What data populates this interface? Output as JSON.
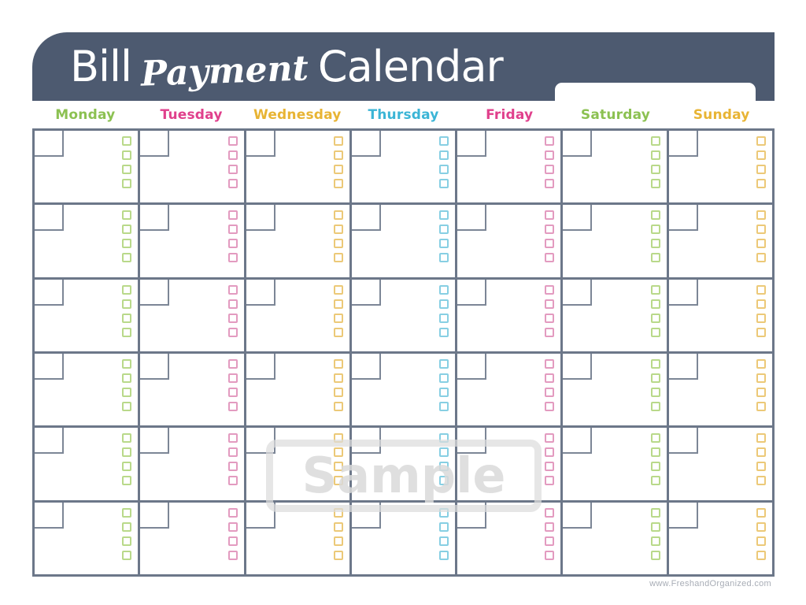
{
  "page": {
    "background": "#ffffff",
    "header_color": "#4d5a70",
    "grid_line_color": "#6c7789"
  },
  "header": {
    "title_part1": "Bill",
    "title_script": "Payment",
    "title_part2": "Calendar",
    "month_input_value": "",
    "month_input_placeholder": ""
  },
  "days": [
    {
      "label": "Monday",
      "color": "#8cc152",
      "check_color": "#b9d98a"
    },
    {
      "label": "Tuesday",
      "color": "#e0408c",
      "check_color": "#e39bc0"
    },
    {
      "label": "Wednesday",
      "color": "#e8b434",
      "check_color": "#ecc978"
    },
    {
      "label": "Thursday",
      "color": "#3bb5d6",
      "check_color": "#87cfe3"
    },
    {
      "label": "Friday",
      "color": "#e0408c",
      "check_color": "#e39bc0"
    },
    {
      "label": "Saturday",
      "color": "#8cc152",
      "check_color": "#b9d98a"
    },
    {
      "label": "Sunday",
      "color": "#e8b434",
      "check_color": "#ecc978"
    }
  ],
  "grid": {
    "rows": 6,
    "columns": 7,
    "checkboxes_per_cell": 4,
    "date_values": [
      [
        "",
        "",
        "",
        "",
        "",
        "",
        ""
      ],
      [
        "",
        "",
        "",
        "",
        "",
        "",
        ""
      ],
      [
        "",
        "",
        "",
        "",
        "",
        "",
        ""
      ],
      [
        "",
        "",
        "",
        "",
        "",
        "",
        ""
      ],
      [
        "",
        "",
        "",
        "",
        "",
        "",
        ""
      ],
      [
        "",
        "",
        "",
        "",
        "",
        "",
        ""
      ]
    ]
  },
  "watermark": {
    "text": "Sample"
  },
  "footer": {
    "url": "www.FreshandOrganized.com"
  }
}
